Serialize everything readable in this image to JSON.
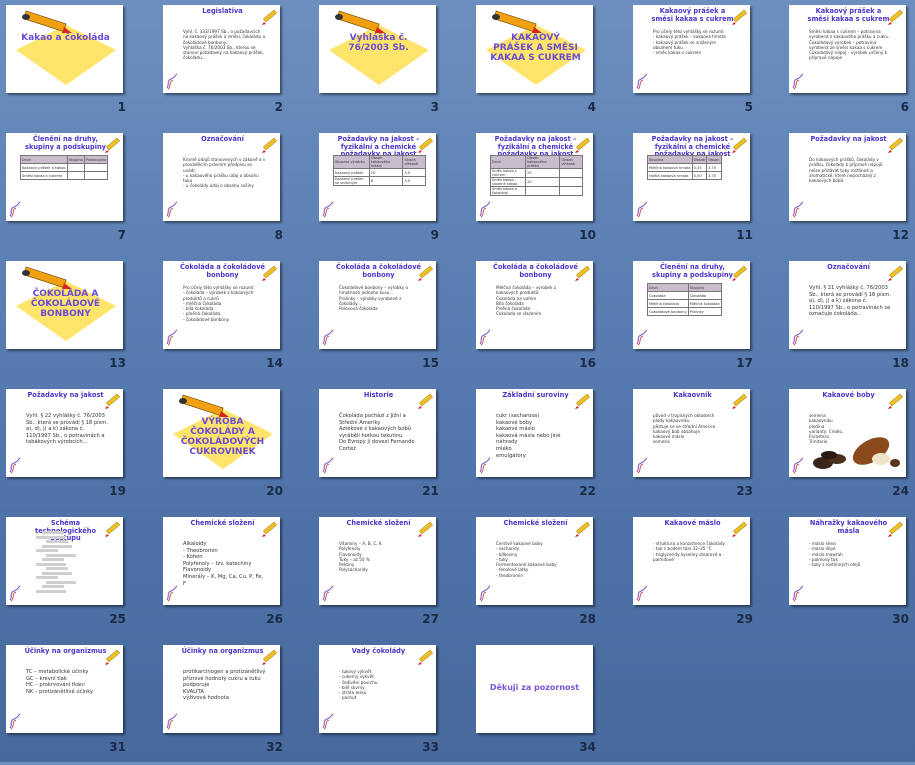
{
  "slides": [
    {
      "num": "1",
      "kind": "title",
      "title": "Kakao a čokoláda"
    },
    {
      "num": "2",
      "kind": "text",
      "title": "Legislativa",
      "body": "Vyhl. č. 333/1997 Sb., o požadavcích na kakaový prášek a směsi, čokoládu a čokoládové bonbony...\nVyhláška č. 76/2003 Sb., kterou se stanoví požadavky na kakaový prášek, čokoládu..."
    },
    {
      "num": "3",
      "kind": "title",
      "title": "Vyhláška č. 76/2003 Sb."
    },
    {
      "num": "4",
      "kind": "title",
      "title": "KAKAOVÝ PRÁŠEK A SMĚSI KAKAA S CUKREM"
    },
    {
      "num": "5",
      "kind": "text",
      "title": "Kakaový prášek a směsi kakaa s cukrem",
      "body": "Pro účely této vyhlášky se rozumí:\n- kakaový prášek – kakaová hmota\n- kakaový prášek se sníženým obsahem tuku\n- směs kakaa s cukrem"
    },
    {
      "num": "6",
      "kind": "text",
      "title": "Kakaový prášek a směsi kakaa s cukrem",
      "body": "Směsi kakaa s cukrem – potravina vyrobená z kakaového prášku a cukru\nČokoládový výrobek – potravina vyrobená ze směsi kakaa s cukrem\nČokoládový nápoj – výrobek určený k přípravě nápoje"
    },
    {
      "num": "7",
      "kind": "table",
      "title": "Členění na druhy, skupiny a podskupiny",
      "rows": [
        [
          "Druh",
          "Skupina",
          "Podskupina"
        ],
        [
          "Kakaový prášek a kakao",
          "",
          ""
        ],
        [
          "Směsi kakaa s cukrem",
          "",
          ""
        ]
      ]
    },
    {
      "num": "8",
      "kind": "text",
      "title": "Označování",
      "body": "Kromě údajů stanovených v zákoně a v prováděcím právním předpisu se uvádí:\n- u kakaového prášku údaj o obsahu tuku\n- u čokolády údaj o obsahu sušiny"
    },
    {
      "num": "9",
      "kind": "table",
      "title": "Požadavky na jakost –fyzikální a chemické požadavky na jakost",
      "rows": [
        [
          "Skupina výrobku",
          "Obsah kakaového máslo",
          "Obsah vlhkosti"
        ],
        [
          "Kakaový prášek",
          "20",
          "5,0"
        ],
        [
          "Kakaový prášek se sníženým",
          "8",
          "5,0"
        ]
      ]
    },
    {
      "num": "10",
      "kind": "table",
      "title": "Požadavky na jakost –fyzikální a chemické požadavky na jakost",
      "rows": [
        [
          "Druh",
          "Obsah kakaového prášku",
          "Obsah vlhkosti"
        ],
        [
          "Směs kakaa s cukrem",
          "25",
          ""
        ],
        [
          "Směs kakaa – slazené kakao",
          "20",
          ""
        ],
        [
          "Směs kakaa a čokolády",
          "",
          ""
        ]
      ]
    },
    {
      "num": "11",
      "kind": "table",
      "title": "Požadavky na jakost –fyzikální a chemické požadavky na jakost",
      "rows": [
        [
          "Skupina",
          "Obsah",
          "Obsah"
        ],
        [
          "Mléčná kakaová hmota",
          "0,35",
          "3,70"
        ],
        [
          "Hořká kakaová hmota",
          "0,50",
          "3,70"
        ]
      ]
    },
    {
      "num": "12",
      "kind": "text",
      "title": "Požadavky na jakost",
      "body": "Do kakaových prášků, čokolády v prášku, čokolády k přípravě nápojů nelze přidávat tuky rostlinné a aromatické, které nepocházejí z kakaových bobů."
    },
    {
      "num": "13",
      "kind": "title",
      "title": "ČOKOLÁDA A ČOKOLÁDOVÉ BONBONY"
    },
    {
      "num": "14",
      "kind": "text",
      "title": "Čokoláda a čokoládové bonbony",
      "body": "Pro účely této vyhlášky se rozumí:\n- čokoláda – výrobek z kakaových produktů a cukrů\n- mléčná čokoláda\n- bílá čokoláda\n- plněná čokoláda\n- čokoládové bonbony"
    },
    {
      "num": "15",
      "kind": "text",
      "title": "Čokoláda a čokoládové bonbony",
      "body": "Čokoládové bonbony – výrobky o hmotnosti jednoho kusu...\nPralinky – výrobky vyrobené z čokolády...\nPolevová čokoláda"
    },
    {
      "num": "16",
      "kind": "text",
      "title": "Čokoláda a čokoládové bonbony",
      "body": "Mléčná čokoláda – výrobek z kakaových produktů\nČokoláda na vaření\nBílá čokoláda\nPlněná čokoláda\nČokoláda se slazením"
    },
    {
      "num": "17",
      "kind": "table",
      "title": "Členění na druhy, skupiny a podskupiny",
      "rows": [
        [
          "Druh",
          "Skupina"
        ],
        [
          "Čokoláda",
          "Čokoláda"
        ],
        [
          "Mléčná čokoláda",
          "Mléčná čokoláda"
        ],
        [
          "Čokoládové bonbony",
          "Pralinky"
        ]
      ]
    },
    {
      "num": "18",
      "kind": "text",
      "big": true,
      "title": "Označování",
      "body": "Vyhl. § 21 vyhlášky č. 76/2003 Sb., která se provádí § 18 písm. a), d), j) a k) zákona č. 110/1997 Sb., o potravinách se označuje čokoláda..."
    },
    {
      "num": "19",
      "kind": "text",
      "big": true,
      "title": "Požadavky na jakost",
      "body": "Vyhl. § 22 vyhlášky č. 76/2003 Sb., která se provádí § 18 písm. a), d), j) a k) zákona č. 110/1997 Sb., o potravinách a tabákových výrobcích..."
    },
    {
      "num": "20",
      "kind": "title",
      "title": "VÝROBA ČOKOLÁDY A ČOKOLÁDOVÝCH CUKROVINEK"
    },
    {
      "num": "21",
      "kind": "text",
      "big": true,
      "title": "Historie",
      "body": "Čokoláda pochází z Jižní a Střední Ameriky\nAztékové z kakaových bobů vyráběli horkou tekutinu\nDo Evropy ji dovezl Fernando Cortéz"
    },
    {
      "num": "22",
      "kind": "text",
      "big": true,
      "title": "Základní suroviny",
      "body": "cukr (sacharosa)\nkakaové boby\nkakaové máslo\nkakaová másla nebo jiné náhrady\nmléko\nemulgátory"
    },
    {
      "num": "23",
      "kind": "text",
      "title": "Kakaovník",
      "body": "původ v tropických oblastech\nplody kakaovníku\npěstuje se ve střední Americe\nkakaový bob obsahuje\nkakaové máslo\nsemena"
    },
    {
      "num": "24",
      "kind": "beans",
      "title": "Kakaové boby",
      "body": "semena kakaovníku\nplodina\nvarianty: Criollo, Forastero, Trinitario"
    },
    {
      "num": "25",
      "kind": "diagram",
      "title": "Schéma technologického postupu"
    },
    {
      "num": "26",
      "kind": "text",
      "big": true,
      "title": "Chemické složení",
      "body": "Alkaloidy\n- Theobromin\n- Kofein\nPolyfenoly – tzv. katechiny\nFlavonoidy\nMinerály – K, Mg, Ca, Cu, P, Fe, F"
    },
    {
      "num": "27",
      "kind": "text",
      "title": "Chemické složení",
      "body": "Vitamíny – A, B, C, K\nPolyfenoly\nFlavonoidy\nTuky – až 50 %\nPektiny\nPolysacharidy"
    },
    {
      "num": "28",
      "kind": "text",
      "title": "Chemické složení",
      "body": "Čerstvé kakaové boby\n- sacharidy\n- bílkoviny\n- tuky\nFermentované kakaové boby\n- fenolové látky\n- theobromin"
    },
    {
      "num": "29",
      "kind": "text",
      "title": "Kakaové máslo",
      "body": "- struktura a konzistence čokolády\n- tuk s bodem tání 32–35 °C\n- triglyceridy kyseliny stearové a palmitové"
    },
    {
      "num": "30",
      "kind": "text",
      "title": "Náhražky kakaového másla",
      "body": "- máslo shea\n- máslo illipé\n- máslo mowrah\n- palmový tuk\n- tuky z rostlinných olejů"
    },
    {
      "num": "31",
      "kind": "text",
      "big": true,
      "title": "Účinky na organizmus",
      "body": "TC – metabolické účinky\nGC – krevní tlak\nHC – prokrvování tkání\nNK – protizánětlivé účinky"
    },
    {
      "num": "32",
      "kind": "text",
      "big": true,
      "title": "Účinky na organizmus",
      "body": "protikarcinogen a protizánětlivý\npříznivé hodnoty cukru a tuku\npodporuje\nKVALITA\nvýživová hodnota"
    },
    {
      "num": "33",
      "kind": "text",
      "title": "Vady čokolády",
      "body": "- tukový výkvět\n- cukerný výkvět\n- šedivění povrchu\n- bílé skvrny\n- ztráta lesku\n- pachuť"
    },
    {
      "num": "34",
      "kind": "thanks",
      "title": "Děkuji za pozornost"
    }
  ]
}
